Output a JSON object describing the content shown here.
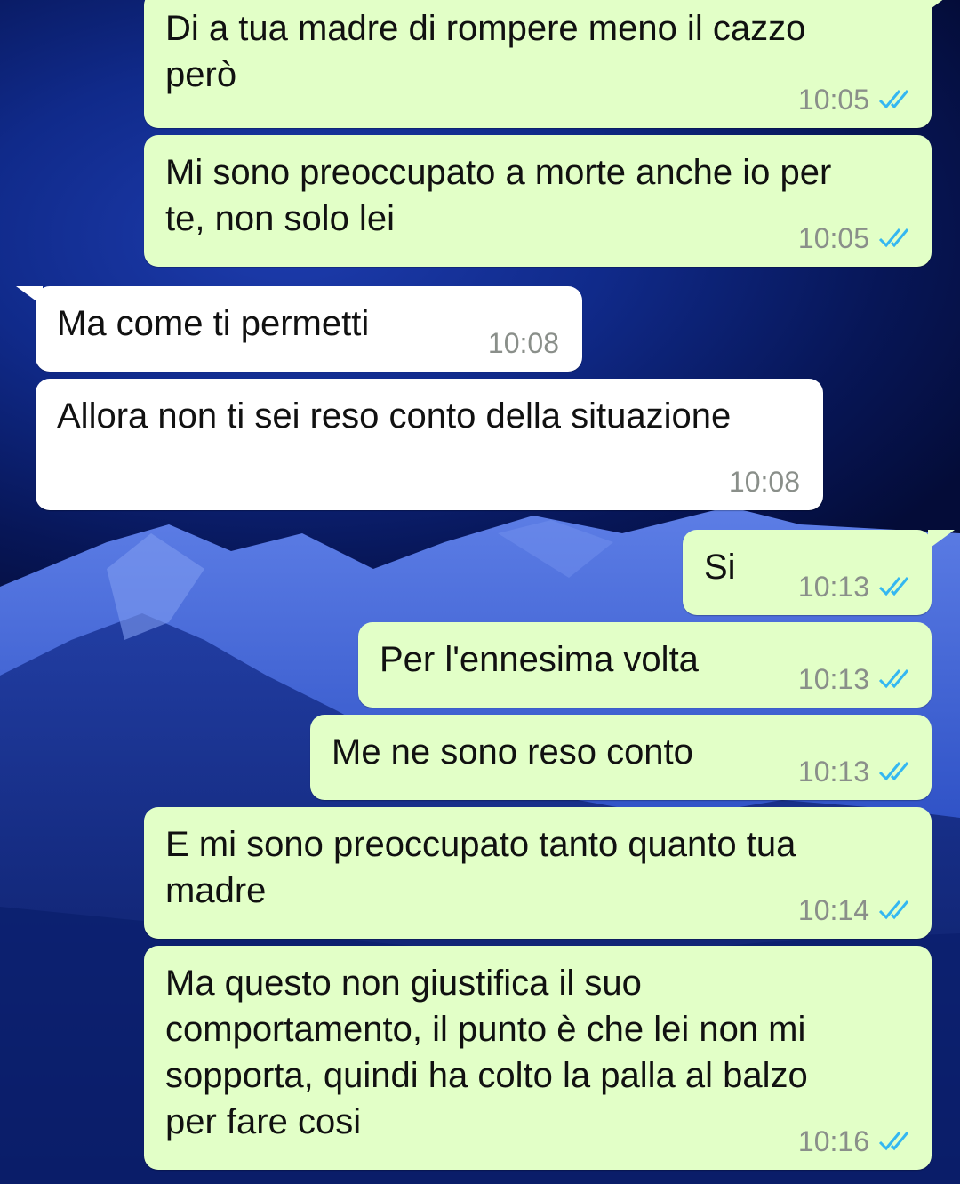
{
  "conversation": {
    "messages": [
      {
        "direction": "outgoing",
        "text": "Di a tua madre di rompere meno il cazzo\nperò",
        "time": "10:05",
        "status": "read"
      },
      {
        "direction": "outgoing",
        "text": "Mi sono preoccupato a morte anche io per\nte, non solo lei",
        "time": "10:05",
        "status": "read"
      },
      {
        "direction": "incoming",
        "text": "Ma come ti permetti",
        "time": "10:08"
      },
      {
        "direction": "incoming",
        "text": "Allora non ti sei reso conto della situazione",
        "time": "10:08"
      },
      {
        "direction": "outgoing",
        "text": "Si",
        "time": "10:13",
        "status": "read"
      },
      {
        "direction": "outgoing",
        "text": "Per l'ennesima volta",
        "time": "10:13",
        "status": "read"
      },
      {
        "direction": "outgoing",
        "text": "Me ne sono reso conto",
        "time": "10:13",
        "status": "read"
      },
      {
        "direction": "outgoing",
        "text": "E mi sono preoccupato tanto quanto tua\nmadre",
        "time": "10:14",
        "status": "read"
      },
      {
        "direction": "outgoing",
        "text": "Ma questo non giustifica il suo\ncomportamento, il punto è che lei non mi\nsopporta, quindi ha colto la palla al balzo\nper fare cosi",
        "time": "10:16",
        "status": "read"
      }
    ]
  },
  "colors": {
    "outgoing_bubble": "#e2ffc7",
    "incoming_bubble": "#ffffff",
    "read_ticks": "#34b7f1",
    "timestamp": "#8a8f8a"
  },
  "icons": {
    "read_receipt": "double-check-icon",
    "wallpaper": "night-mountains-wallpaper"
  }
}
